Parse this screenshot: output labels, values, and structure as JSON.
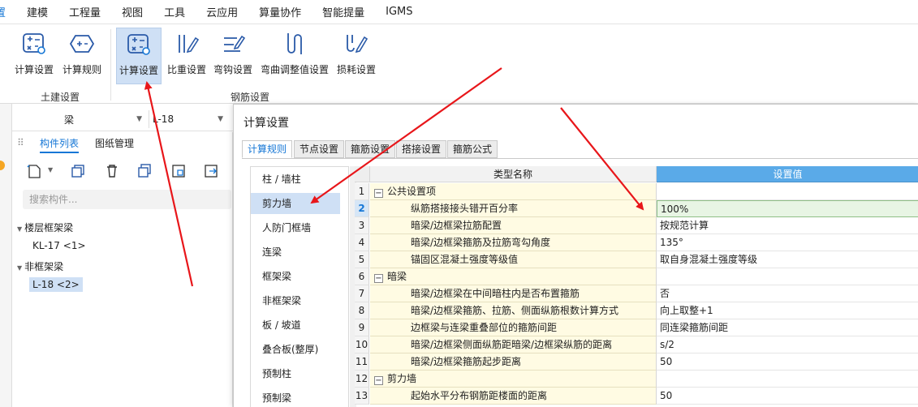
{
  "menu": [
    "置",
    "建模",
    "工程量",
    "视图",
    "工具",
    "云应用",
    "算量协作",
    "智能提量",
    "IGMS"
  ],
  "ribbon": {
    "civil": {
      "label": "土建设置",
      "buttons": [
        {
          "label": "计算设置",
          "icon": "calc-settings-icon"
        },
        {
          "label": "计算规则",
          "icon": "calc-rules-icon"
        }
      ]
    },
    "rebar": {
      "label": "钢筋设置",
      "buttons": [
        {
          "label": "计算设置",
          "icon": "calc-settings-icon"
        },
        {
          "label": "比重设置",
          "icon": "weight-settings-icon"
        },
        {
          "label": "弯钩设置",
          "icon": "hook-settings-icon"
        },
        {
          "label": "弯曲调整值设置",
          "icon": "bend-adjust-icon"
        },
        {
          "label": "损耗设置",
          "icon": "loss-settings-icon"
        }
      ]
    }
  },
  "toolbar2": {
    "combo1": "梁",
    "combo2": "L-18"
  },
  "panel": {
    "tabs": [
      "构件列表",
      "图纸管理"
    ],
    "search_placeholder": "搜索构件...",
    "tree": [
      {
        "group": "楼层框架梁",
        "items": [
          "KL-17 <1>"
        ]
      },
      {
        "group": "非框架梁",
        "items": [
          "L-18 <2>"
        ]
      }
    ]
  },
  "dialog": {
    "title": "计算设置",
    "tabs": [
      "计算规则",
      "节点设置",
      "箍筋设置",
      "搭接设置",
      "箍筋公式"
    ],
    "categories": [
      "柱 / 墙柱",
      "剪力墙",
      "人防门框墙",
      "连梁",
      "框架梁",
      "非框架梁",
      "板 / 坡道",
      "叠合板(整厚)",
      "预制柱",
      "预制梁"
    ],
    "header": {
      "name": "类型名称",
      "value": "设置值"
    },
    "rows": [
      {
        "n": "1",
        "name": "公共设置项",
        "value": "",
        "group": true
      },
      {
        "n": "2",
        "name": "纵筋搭接接头错开百分率",
        "value": "100%",
        "group": false
      },
      {
        "n": "3",
        "name": "暗梁/边框梁拉筋配置",
        "value": "按规范计算",
        "group": false
      },
      {
        "n": "4",
        "name": "暗梁/边框梁箍筋及拉筋弯勾角度",
        "value": "135°",
        "group": false
      },
      {
        "n": "5",
        "name": "锚固区混凝土强度等级值",
        "value": "取自身混凝土强度等级",
        "group": false
      },
      {
        "n": "6",
        "name": "暗梁",
        "value": "",
        "group": true
      },
      {
        "n": "7",
        "name": "暗梁/边框梁在中间暗柱内是否布置箍筋",
        "value": "否",
        "group": false
      },
      {
        "n": "8",
        "name": "暗梁/边框梁箍筋、拉筋、侧面纵筋根数计算方式",
        "value": "向上取整+1",
        "group": false
      },
      {
        "n": "9",
        "name": "边框梁与连梁重叠部位的箍筋间距",
        "value": "同连梁箍筋间距",
        "group": false
      },
      {
        "n": "10",
        "name": "暗梁/边框梁侧面纵筋距暗梁/边框梁纵筋的距离",
        "value": "s/2",
        "group": false
      },
      {
        "n": "11",
        "name": "暗梁/边框梁箍筋起步距离",
        "value": "50",
        "group": false
      },
      {
        "n": "12",
        "name": "剪力墙",
        "value": "",
        "group": true
      },
      {
        "n": "13",
        "name": "起始水平分布钢筋距楼面的距离",
        "value": "50",
        "group": false
      }
    ]
  },
  "colors": {
    "accent": "#1677d6",
    "selected": "#cfe0f5",
    "arrow": "#e8161a",
    "name_col": "#fffbe3",
    "header_value": "#5aaae8"
  }
}
